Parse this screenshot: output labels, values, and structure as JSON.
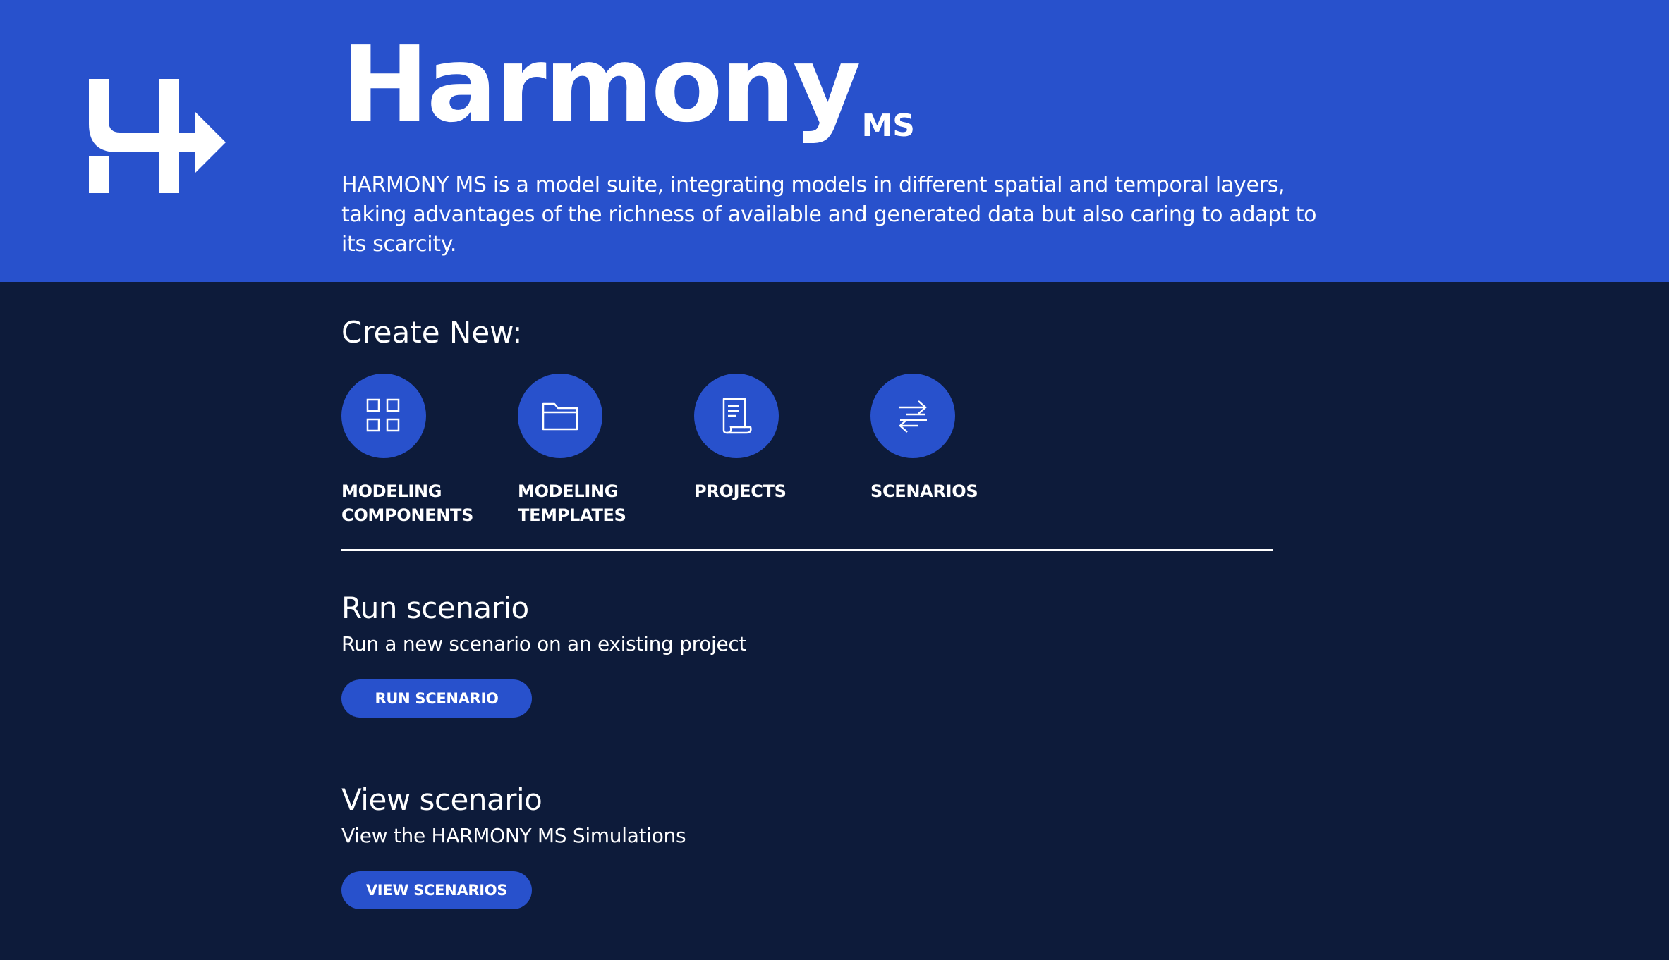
{
  "hero": {
    "logo_icon": "harmony-h-arrow-logo",
    "brand_name": "Harmony",
    "brand_suffix": "MS",
    "description": "HARMONY MS is a model suite, integrating models in different spatial and temporal layers, taking advantages of the richness of available and generated data but also caring to adapt to its scarcity."
  },
  "create": {
    "title": "Create New:",
    "items": [
      {
        "label": "MODELING\nCOMPONENTS",
        "icon": "grid-icon"
      },
      {
        "label": "MODELING\nTEMPLATES",
        "icon": "folder-icon"
      },
      {
        "label": "PROJECTS",
        "icon": "document-scroll-icon"
      },
      {
        "label": "SCENARIOS",
        "icon": "swap-arrows-icon"
      }
    ]
  },
  "run": {
    "title": "Run scenario",
    "description": "Run a new scenario on an existing project",
    "button": "RUN SCENARIO"
  },
  "view": {
    "title": "View scenario",
    "description": "View the HARMONY MS Simulations",
    "button": "VIEW SCENARIOS"
  },
  "colors": {
    "hero_bg": "#2851cc",
    "page_bg": "#0d1b3a",
    "accent": "#2851cc",
    "text": "#ffffff"
  }
}
